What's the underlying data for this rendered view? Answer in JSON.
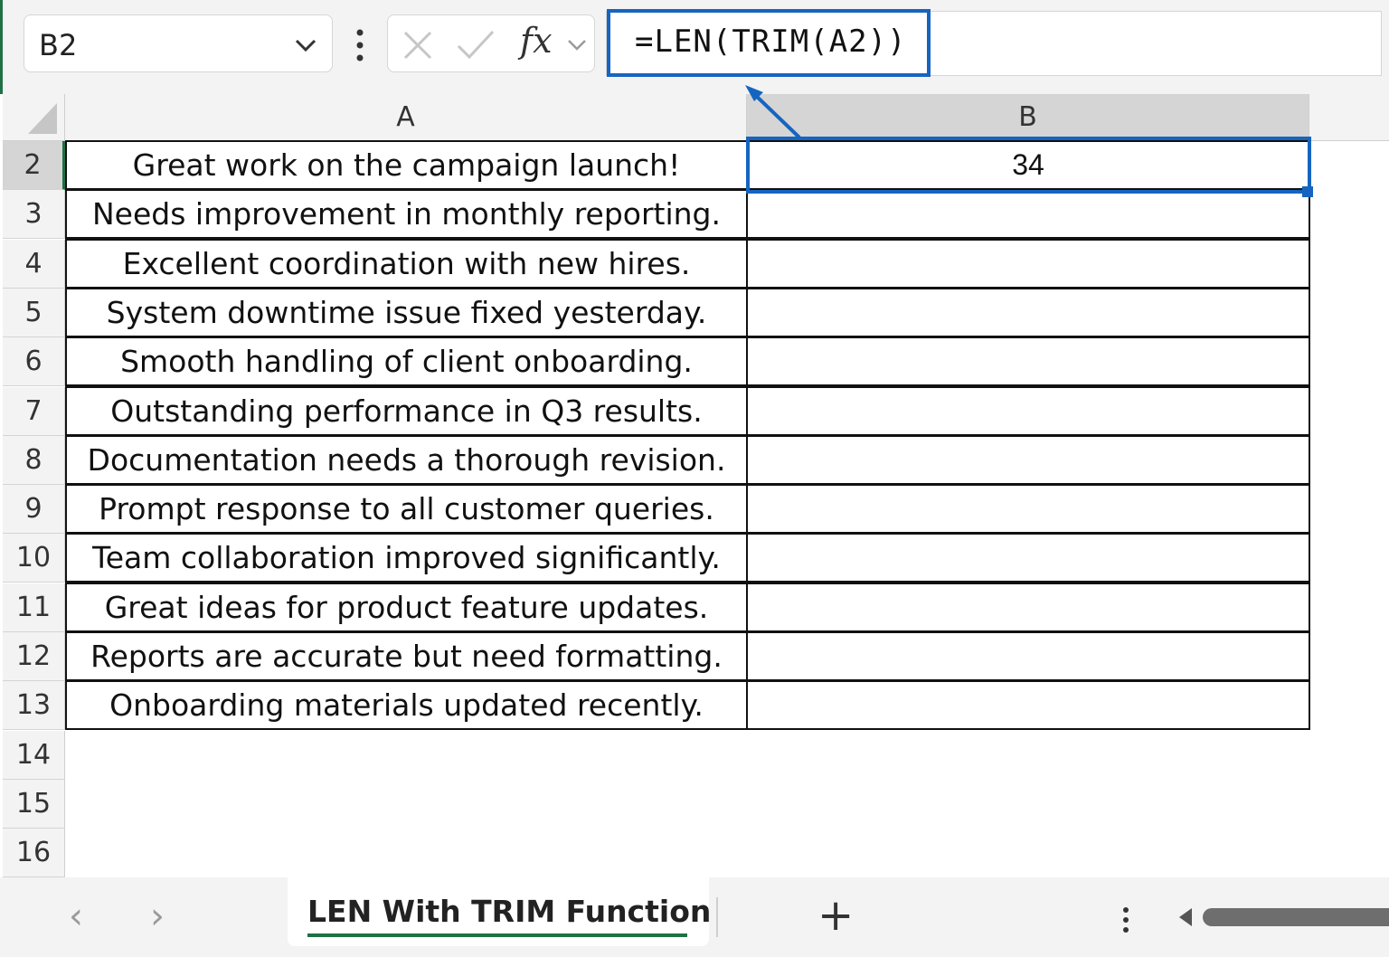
{
  "namebox": {
    "value": "B2"
  },
  "formula_bar": {
    "fx_label": "fx",
    "formula": "=LEN(TRIM(A2))"
  },
  "columns": [
    "A",
    "B"
  ],
  "rows": [
    {
      "num": "2",
      "a": "Great work on the campaign launch!",
      "b": "34"
    },
    {
      "num": "3",
      "a": "Needs improvement in monthly reporting.",
      "b": ""
    },
    {
      "num": "4",
      "a": "Excellent coordination with new hires.",
      "b": ""
    },
    {
      "num": "5",
      "a": "System downtime issue fixed yesterday.",
      "b": ""
    },
    {
      "num": "6",
      "a": "Smooth handling of client onboarding.",
      "b": ""
    },
    {
      "num": "7",
      "a": "Outstanding performance in Q3 results.",
      "b": ""
    },
    {
      "num": "8",
      "a": "Documentation needs a thorough revision.",
      "b": ""
    },
    {
      "num": "9",
      "a": "Prompt response to all customer queries.",
      "b": ""
    },
    {
      "num": "10",
      "a": "Team collaboration improved significantly.",
      "b": ""
    },
    {
      "num": "11",
      "a": "Great ideas for product feature updates.",
      "b": ""
    },
    {
      "num": "12",
      "a": "Reports are accurate but need formatting.",
      "b": ""
    },
    {
      "num": "13",
      "a": "Onboarding materials updated recently.",
      "b": ""
    }
  ],
  "empty_rows": [
    "14",
    "15",
    "16"
  ],
  "sheet_tabs": {
    "active": "LEN With TRIM Function"
  },
  "colors": {
    "accent_blue": "#1565c0",
    "excel_green": "#1e7145"
  }
}
